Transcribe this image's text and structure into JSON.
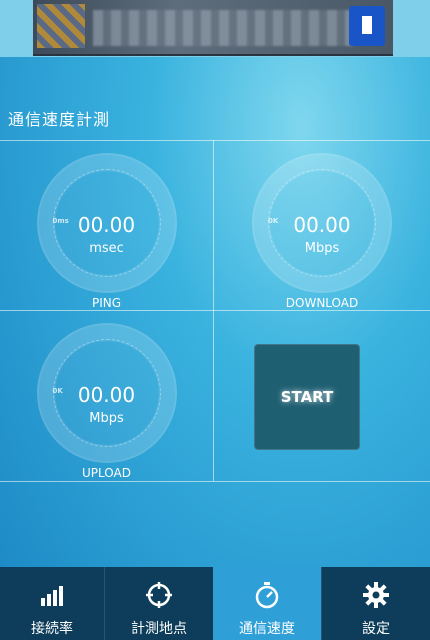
{
  "page": {
    "title": "通信速度計測"
  },
  "gauges": {
    "ping": {
      "min": "0ms",
      "value": "00.00",
      "unit": "msec",
      "label": "PING"
    },
    "download": {
      "min": "0K",
      "value": "00.00",
      "unit": "Mbps",
      "label": "DOWNLOAD"
    },
    "upload": {
      "min": "0K",
      "value": "00.00",
      "unit": "Mbps",
      "label": "UPLOAD"
    }
  },
  "start_button": {
    "label": "START"
  },
  "nav": {
    "items": [
      {
        "label": "接続率",
        "icon": "signal-bars-icon",
        "active": false
      },
      {
        "label": "計測地点",
        "icon": "crosshair-icon",
        "active": false
      },
      {
        "label": "通信速度",
        "icon": "stopwatch-icon",
        "active": true
      },
      {
        "label": "設定",
        "icon": "gear-icon",
        "active": false
      }
    ]
  },
  "colors": {
    "nav_bg": "#0d3d5a",
    "nav_active": "#2f9fd8",
    "start_bg": "#1f5f72"
  }
}
